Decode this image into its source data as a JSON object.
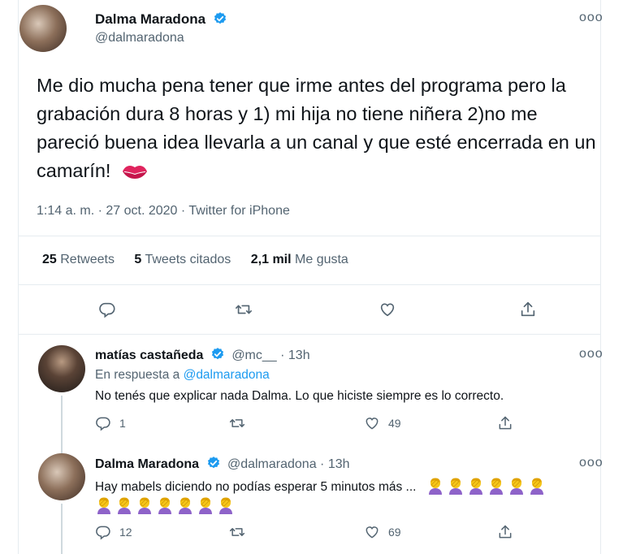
{
  "tweet": {
    "author_name": "Dalma Maradona",
    "author_handle": "@dalmaradona",
    "text": "Me dio mucha pena tener que irme antes del programa pero la grabación dura 8 horas y 1) mi hija no tiene niñera 2)no me pareció buena idea llevarla a un canal y que esté encerrada en un camarín!",
    "emoji": "kiss-mark",
    "meta": "1:14 a. m. · 27 oct. 2020 · Twitter for iPhone",
    "stats": {
      "retweets_count": "25",
      "retweets_label": "Retweets",
      "quotes_count": "5",
      "quotes_label": "Tweets citados",
      "likes_count": "2,1 mil",
      "likes_label": "Me gusta"
    },
    "more_label": "ooo"
  },
  "replies": [
    {
      "author_name": "matías castañeda",
      "author_handle": "@mc__ · 13h",
      "reply_to_prefix": "En respuesta a ",
      "reply_to_handle": "@dalmaradona",
      "text": "No tenés que explicar nada Dalma. Lo que hiciste siempre es lo correcto.",
      "reply_count": "1",
      "retweet_count": "",
      "like_count": "49",
      "more_label": "ooo"
    },
    {
      "author_name": "Dalma Maradona",
      "author_handle": "@dalmaradona · 13h",
      "text": "Hay mabels diciendo no podías esperar 5 minutos más ...",
      "emoji": "woman-facepalming",
      "emoji_count_line1": 6,
      "emoji_count_line2": 7,
      "reply_count": "12",
      "retweet_count": "",
      "like_count": "69",
      "more_label": "ooo"
    }
  ],
  "icons": [
    "verified-badge-icon",
    "reply-icon",
    "retweet-icon",
    "like-icon",
    "share-icon",
    "more-icon"
  ],
  "colors": {
    "accent": "#1d9bf0",
    "secondary_text": "#536471",
    "divider": "#e6ecf0",
    "kiss": "#e0245e",
    "emoji_yellow": "#f5c518",
    "emoji_purple": "#8e63c9"
  }
}
